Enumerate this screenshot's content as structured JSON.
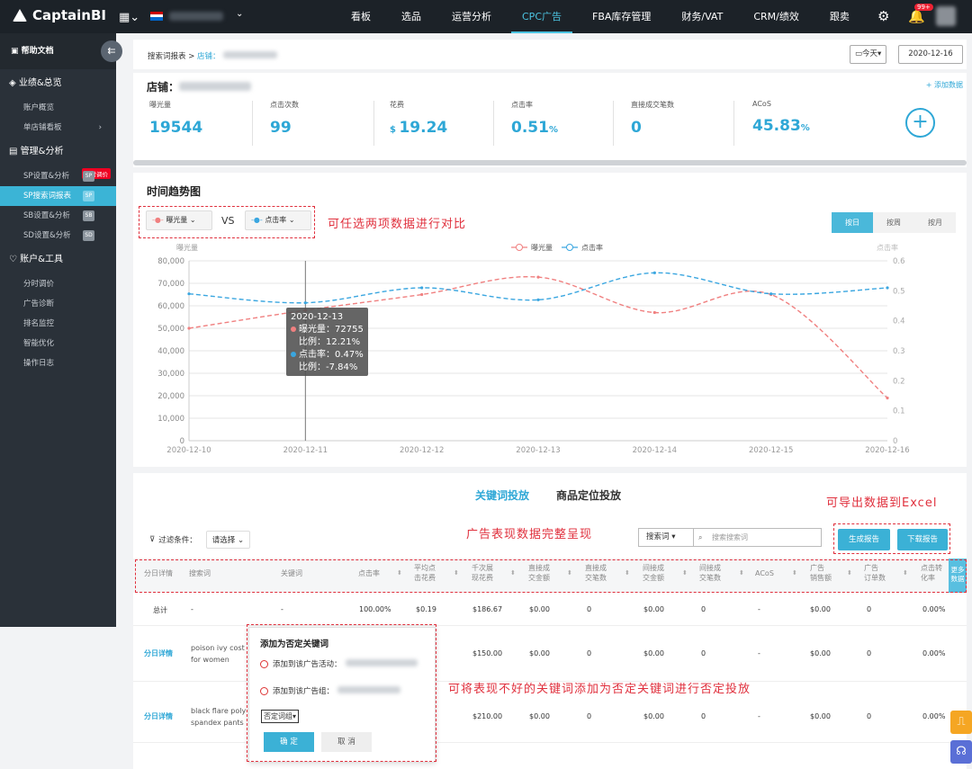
{
  "topbar": {
    "brand": "CaptainBI",
    "nav": [
      "看板",
      "选品",
      "运营分析",
      "CPC广告",
      "FBA库存管理",
      "财务/VAT",
      "CRM/绩效",
      "跟卖"
    ],
    "active_nav": "CPC广告",
    "badge": "99+"
  },
  "sidebar": {
    "help": "帮助文档",
    "sec1": "业绩&总览",
    "sec1_items": [
      "账户概览",
      "单店铺看板"
    ],
    "sec2": "管理&分析",
    "sec2_badge": "分时调价",
    "sec2_items": [
      {
        "label": "SP设置&分析",
        "tag": "SP"
      },
      {
        "label": "SP搜索词报表",
        "tag": "SP",
        "active": true
      },
      {
        "label": "SB设置&分析",
        "tag": "SB"
      },
      {
        "label": "SD设置&分析",
        "tag": "SD"
      }
    ],
    "sec3": "账户&工具",
    "sec3_items": [
      "分时调价",
      "广告诊断",
      "排名监控",
      "智能优化",
      "操作日志"
    ]
  },
  "crumb": {
    "root": "搜索词报表",
    "sep": " > ",
    "shop": "店铺：",
    "today": "今天",
    "date": "2020-12-16"
  },
  "stats": {
    "title": "店铺：",
    "add": "+ 添加数据",
    "items": [
      {
        "label": "曝光量",
        "value": "19544",
        "prefix": "",
        "suffix": ""
      },
      {
        "label": "点击次数",
        "value": "99",
        "prefix": "",
        "suffix": ""
      },
      {
        "label": "花费",
        "value": "19.24",
        "prefix": "$ ",
        "suffix": ""
      },
      {
        "label": "点击率",
        "value": "0.51",
        "prefix": "",
        "suffix": "%"
      },
      {
        "label": "直接成交笔数",
        "value": "0",
        "prefix": "",
        "suffix": ""
      },
      {
        "label": "ACoS",
        "value": "45.83",
        "prefix": "",
        "suffix": "%"
      }
    ]
  },
  "trend": {
    "title": "时间趋势图",
    "sel1": "曝光量",
    "sel2": "点击率",
    "vs": "VS",
    "annot": "可任选两项数据进行对比",
    "seg": [
      "按日",
      "按周",
      "按月"
    ],
    "tooltip": {
      "date": "2020-12-13",
      "l1": "曝光量：72755",
      "l2": "比例：12.21%",
      "l3": "点击率：0.47%",
      "l4": "比例：-7.84%"
    }
  },
  "chart_data": {
    "type": "line",
    "x": [
      "2020-12-10",
      "2020-12-11",
      "2020-12-12",
      "2020-12-13",
      "2020-12-14",
      "2020-12-15",
      "2020-12-16"
    ],
    "ylabel": "曝光量",
    "y2label": "点击率",
    "ylim": [
      0,
      80000
    ],
    "y2lim": [
      0,
      0.6
    ],
    "yticks": [
      "0",
      "10,000",
      "20,000",
      "30,000",
      "40,000",
      "50,000",
      "60,000",
      "70,000",
      "80,000"
    ],
    "y2ticks": [
      "0",
      "0.1",
      "0.2",
      "0.3",
      "0.4",
      "0.5",
      "0.6"
    ],
    "series": [
      {
        "name": "曝光量",
        "axis": "left",
        "color": "#f08080",
        "values": [
          50000,
          58000,
          65000,
          72755,
          57000,
          65000,
          19000
        ]
      },
      {
        "name": "点击率",
        "axis": "right",
        "color": "#3aa6e0",
        "values": [
          0.49,
          0.46,
          0.51,
          0.47,
          0.56,
          0.49,
          0.51
        ]
      }
    ],
    "legend": "top-center",
    "grid": true
  },
  "table": {
    "tab1": "关键词投放",
    "tab2": "商品定位投放",
    "filter_label": "过滤条件：",
    "filter_value": "请选择",
    "annot_export": "可导出数据到Excel",
    "annot_full": "广告表现数据完整呈现",
    "search_type": "搜索词",
    "search_placeholder": "搜索搜索词",
    "btn_gen": "生成报告",
    "btn_dl": "下载报告",
    "more": "更多数据",
    "headers": [
      "分日详情",
      "搜索词",
      "关键词",
      "点击率",
      "平均点\n击花费",
      "千次展\n现花费",
      "直接成\n交金额",
      "直接成\n交笔数",
      "间接成\n交金额",
      "间接成\n交笔数",
      "ACoS",
      "广告\n销售额",
      "广告\n订单数",
      "点击转\n化率"
    ],
    "total": {
      "label": "总计",
      "kw": "-",
      "match": "-",
      "ctr": "100.00%",
      "cpc": "$0.19",
      "cpm": "$186.67",
      "ds": "$0.00",
      "dn": "0",
      "is": "$0.00",
      "in": "0",
      "acos": "-",
      "sales": "$0.00",
      "orders": "0",
      "cvr": "0.00%"
    },
    "rows": [
      {
        "detail": "分日详情",
        "kw": "poison ivy cost\nfor women",
        "cpm": "$150.00",
        "ds": "$0.00",
        "dn": "0",
        "is": "$0.00",
        "in": "0",
        "acos": "-",
        "sales": "$0.00",
        "orders": "0",
        "cvr": "0.00%"
      },
      {
        "detail": "分日详情",
        "kw": "black flare poly\nspandex pants",
        "cpm": "$210.00",
        "ds": "$0.00",
        "dn": "0",
        "is": "$0.00",
        "in": "0",
        "acos": "-",
        "sales": "$0.00",
        "orders": "0",
        "cvr": "0.00%"
      }
    ],
    "annot_neg": "可将表现不好的关键词添加为否定关键词进行否定投放"
  },
  "popup": {
    "title": "添加为否定关键词",
    "opt1": "添加到该广告活动：",
    "opt2": "添加到该广告组：",
    "select": "否定词组",
    "ok": "确 定",
    "cancel": "取 消"
  }
}
